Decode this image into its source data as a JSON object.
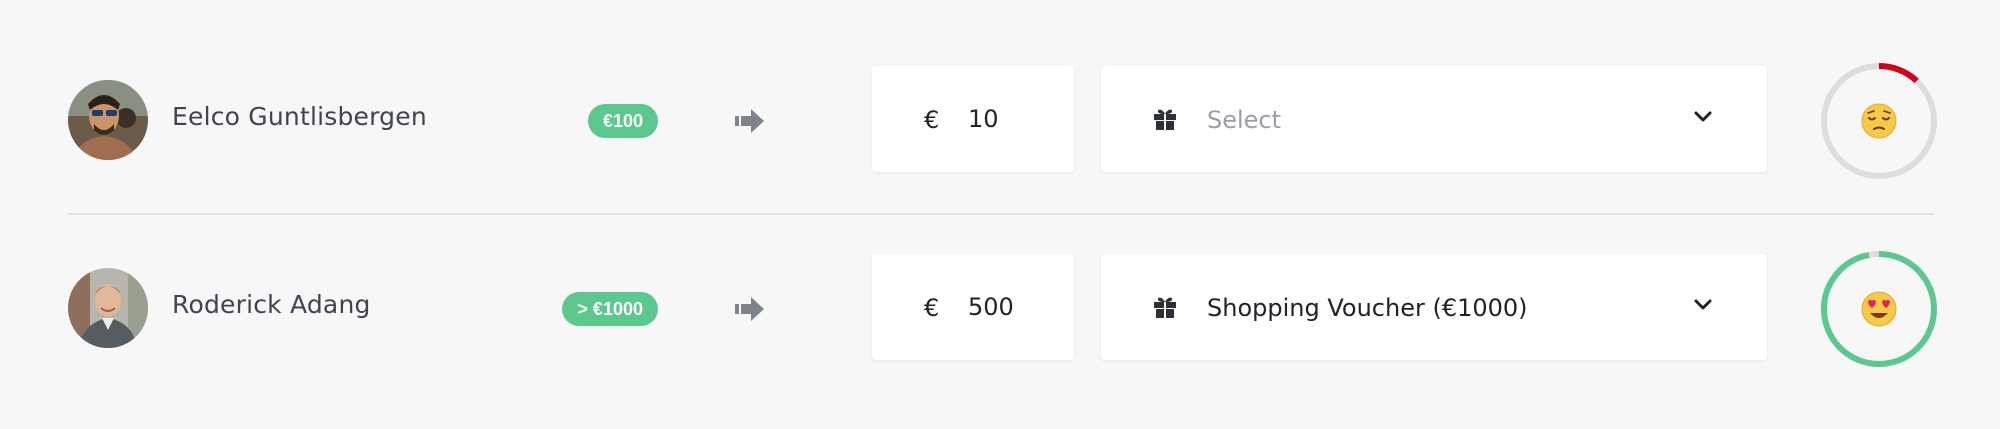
{
  "colors": {
    "background": "#f7f7f7",
    "badge": "#5cc890",
    "gauge_track": "#dddddd",
    "gauge_low": "#d0021b",
    "gauge_high": "#5cc890",
    "arrow": "#7f838a"
  },
  "rows": [
    {
      "name": "Eelco Guntlisbergen",
      "badge": "€100",
      "currency": "€",
      "amount": "10",
      "gift_selection": "Select",
      "gift_is_placeholder": true,
      "satisfaction_fraction": 0.12,
      "emoji": "pensive-face-emoji"
    },
    {
      "name": "Roderick Adang",
      "badge": "> €1000",
      "currency": "€",
      "amount": "500",
      "gift_selection": "Shopping Voucher (€1000)",
      "gift_is_placeholder": false,
      "satisfaction_fraction": 0.97,
      "emoji": "heart-eyes-emoji"
    }
  ]
}
